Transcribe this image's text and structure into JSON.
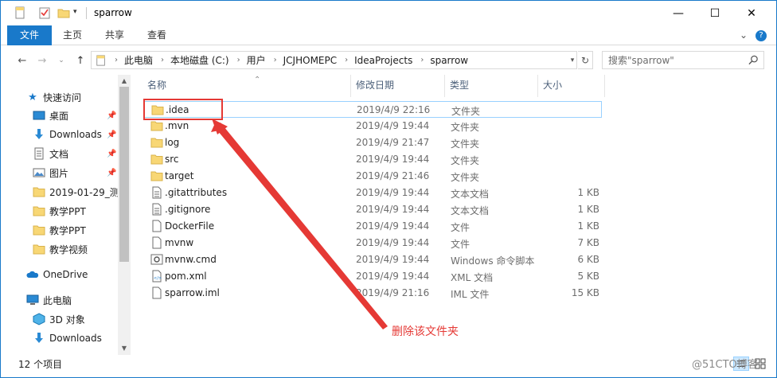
{
  "window": {
    "title": "sparrow",
    "controls": {
      "minimize": "—",
      "maximize": "☐",
      "close": "✕"
    }
  },
  "quick_access_toolbar": {
    "icons": [
      "page-icon",
      "properties-checkmark-icon",
      "new-folder-icon",
      "customize-dropdown-icon"
    ]
  },
  "ribbon": {
    "tabs": [
      "文件",
      "主页",
      "共享",
      "查看"
    ],
    "expand_glyph": "⌄",
    "help_glyph": "?"
  },
  "address_bar": {
    "breadcrumbs": [
      "此电脑",
      "本地磁盘 (C:)",
      "用户",
      "JCJHOMEPC",
      "IdeaProjects",
      "sparrow"
    ],
    "separator": "›"
  },
  "search": {
    "placeholder": "搜索\"sparrow\"",
    "value": ""
  },
  "nav_pane": {
    "items": [
      {
        "label": "快速访问",
        "icon": "star-icon",
        "pinned": false
      },
      {
        "label": "桌面",
        "icon": "desktop-icon",
        "pinned": true
      },
      {
        "label": "Downloads",
        "icon": "download-arrow-icon",
        "pinned": true
      },
      {
        "label": "文档",
        "icon": "document-icon",
        "pinned": true
      },
      {
        "label": "图片",
        "icon": "picture-icon",
        "pinned": true
      },
      {
        "label": "2019-01-29_测试",
        "icon": "folder-icon",
        "pinned": false
      },
      {
        "label": "教学PPT",
        "icon": "folder-icon",
        "pinned": false
      },
      {
        "label": "教学PPT",
        "icon": "folder-icon",
        "pinned": false
      },
      {
        "label": "教学视频",
        "icon": "folder-icon",
        "pinned": false
      },
      {
        "label": "OneDrive",
        "icon": "cloud-icon",
        "pinned": false
      },
      {
        "label": "此电脑",
        "icon": "computer-icon",
        "pinned": false
      },
      {
        "label": "3D 对象",
        "icon": "cube-3d-icon",
        "pinned": false
      },
      {
        "label": "Downloads",
        "icon": "download-arrow-icon",
        "pinned": false
      }
    ],
    "pin_glyph": "📌"
  },
  "file_list": {
    "columns": [
      "名称",
      "修改日期",
      "类型",
      "大小"
    ],
    "rows": [
      {
        "name": ".idea",
        "date": "2019/4/9 22:16",
        "type": "文件夹",
        "size": "",
        "icon": "folder-icon",
        "selected": true
      },
      {
        "name": ".mvn",
        "date": "2019/4/9 19:44",
        "type": "文件夹",
        "size": "",
        "icon": "folder-icon",
        "selected": false
      },
      {
        "name": "log",
        "date": "2019/4/9 21:47",
        "type": "文件夹",
        "size": "",
        "icon": "folder-icon",
        "selected": false
      },
      {
        "name": "src",
        "date": "2019/4/9 19:44",
        "type": "文件夹",
        "size": "",
        "icon": "folder-icon",
        "selected": false
      },
      {
        "name": "target",
        "date": "2019/4/9 21:46",
        "type": "文件夹",
        "size": "",
        "icon": "folder-icon",
        "selected": false
      },
      {
        "name": ".gitattributes",
        "date": "2019/4/9 19:44",
        "type": "文本文档",
        "size": "1 KB",
        "icon": "text-file-icon",
        "selected": false
      },
      {
        "name": ".gitignore",
        "date": "2019/4/9 19:44",
        "type": "文本文档",
        "size": "1 KB",
        "icon": "text-file-icon",
        "selected": false
      },
      {
        "name": "DockerFile",
        "date": "2019/4/9 19:44",
        "type": "文件",
        "size": "1 KB",
        "icon": "blank-file-icon",
        "selected": false
      },
      {
        "name": "mvnw",
        "date": "2019/4/9 19:44",
        "type": "文件",
        "size": "7 KB",
        "icon": "blank-file-icon",
        "selected": false
      },
      {
        "name": "mvnw.cmd",
        "date": "2019/4/9 19:44",
        "type": "Windows 命令脚本",
        "size": "6 KB",
        "icon": "script-gear-icon",
        "selected": false
      },
      {
        "name": "pom.xml",
        "date": "2019/4/9 19:44",
        "type": "XML 文档",
        "size": "5 KB",
        "icon": "xml-file-icon",
        "selected": false
      },
      {
        "name": "sparrow.iml",
        "date": "2019/4/9 21:16",
        "type": "IML 文件",
        "size": "15 KB",
        "icon": "blank-file-icon",
        "selected": false
      }
    ]
  },
  "status_bar": {
    "item_count": "12 个项目"
  },
  "annotation": {
    "text": "删除该文件夹",
    "color": "#e53935"
  },
  "watermark": {
    "text": "@51CTO博客"
  },
  "colors": {
    "accent": "#1979ca",
    "folder": "#f8d775",
    "selection_border": "#99d1ff",
    "annotation_red": "#e53935"
  }
}
